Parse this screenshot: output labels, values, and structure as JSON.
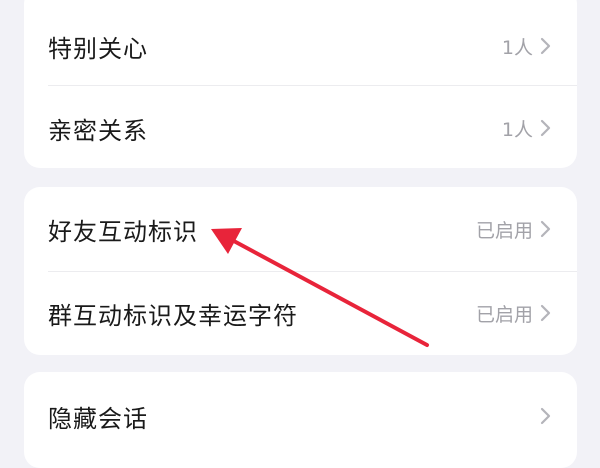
{
  "group1": {
    "items": [
      {
        "label": "特别关心",
        "value": "1人"
      },
      {
        "label": "亲密关系",
        "value": "1人"
      }
    ]
  },
  "group2": {
    "items": [
      {
        "label": "好友互动标识",
        "value": "已启用"
      },
      {
        "label": "群互动标识及幸运字符",
        "value": "已启用"
      }
    ]
  },
  "group3": {
    "items": [
      {
        "label": "隐藏会话",
        "value": ""
      }
    ]
  },
  "colors": {
    "background": "#f2f2f7",
    "card": "#ffffff",
    "label_text": "#1a1a1a",
    "value_text": "#a2a2a8",
    "annotation_arrow": "#e8243a"
  },
  "icons": {
    "chevron": "chevron-right-icon"
  }
}
